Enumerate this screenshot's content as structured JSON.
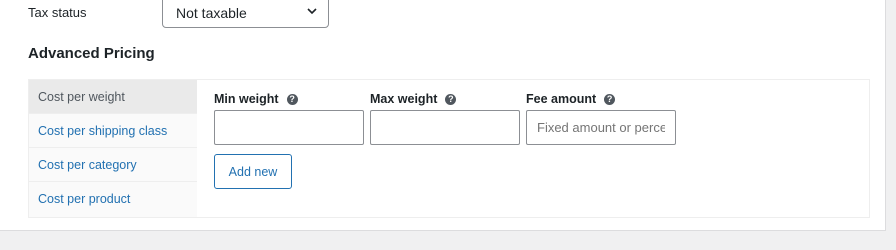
{
  "tax": {
    "label": "Tax status",
    "selected": "Not taxable"
  },
  "advanced_pricing": {
    "title": "Advanced Pricing",
    "tabs": [
      {
        "label": "Cost per weight",
        "active": true
      },
      {
        "label": "Cost per shipping class",
        "active": false
      },
      {
        "label": "Cost per category",
        "active": false
      },
      {
        "label": "Cost per product",
        "active": false
      }
    ],
    "columns": [
      {
        "label": "Min weight",
        "value": "",
        "placeholder": ""
      },
      {
        "label": "Max weight",
        "value": "",
        "placeholder": ""
      },
      {
        "label": "Fee amount",
        "value": "",
        "placeholder": "Fixed amount or percentage"
      }
    ],
    "add_button": "Add new"
  },
  "icons": {
    "help": "help-icon",
    "dropdown": "chevron-down-icon"
  },
  "colors": {
    "link": "#2271b1",
    "text": "#1d2327",
    "background": "#f0f0f1",
    "active_tab": "#eaeaea"
  }
}
